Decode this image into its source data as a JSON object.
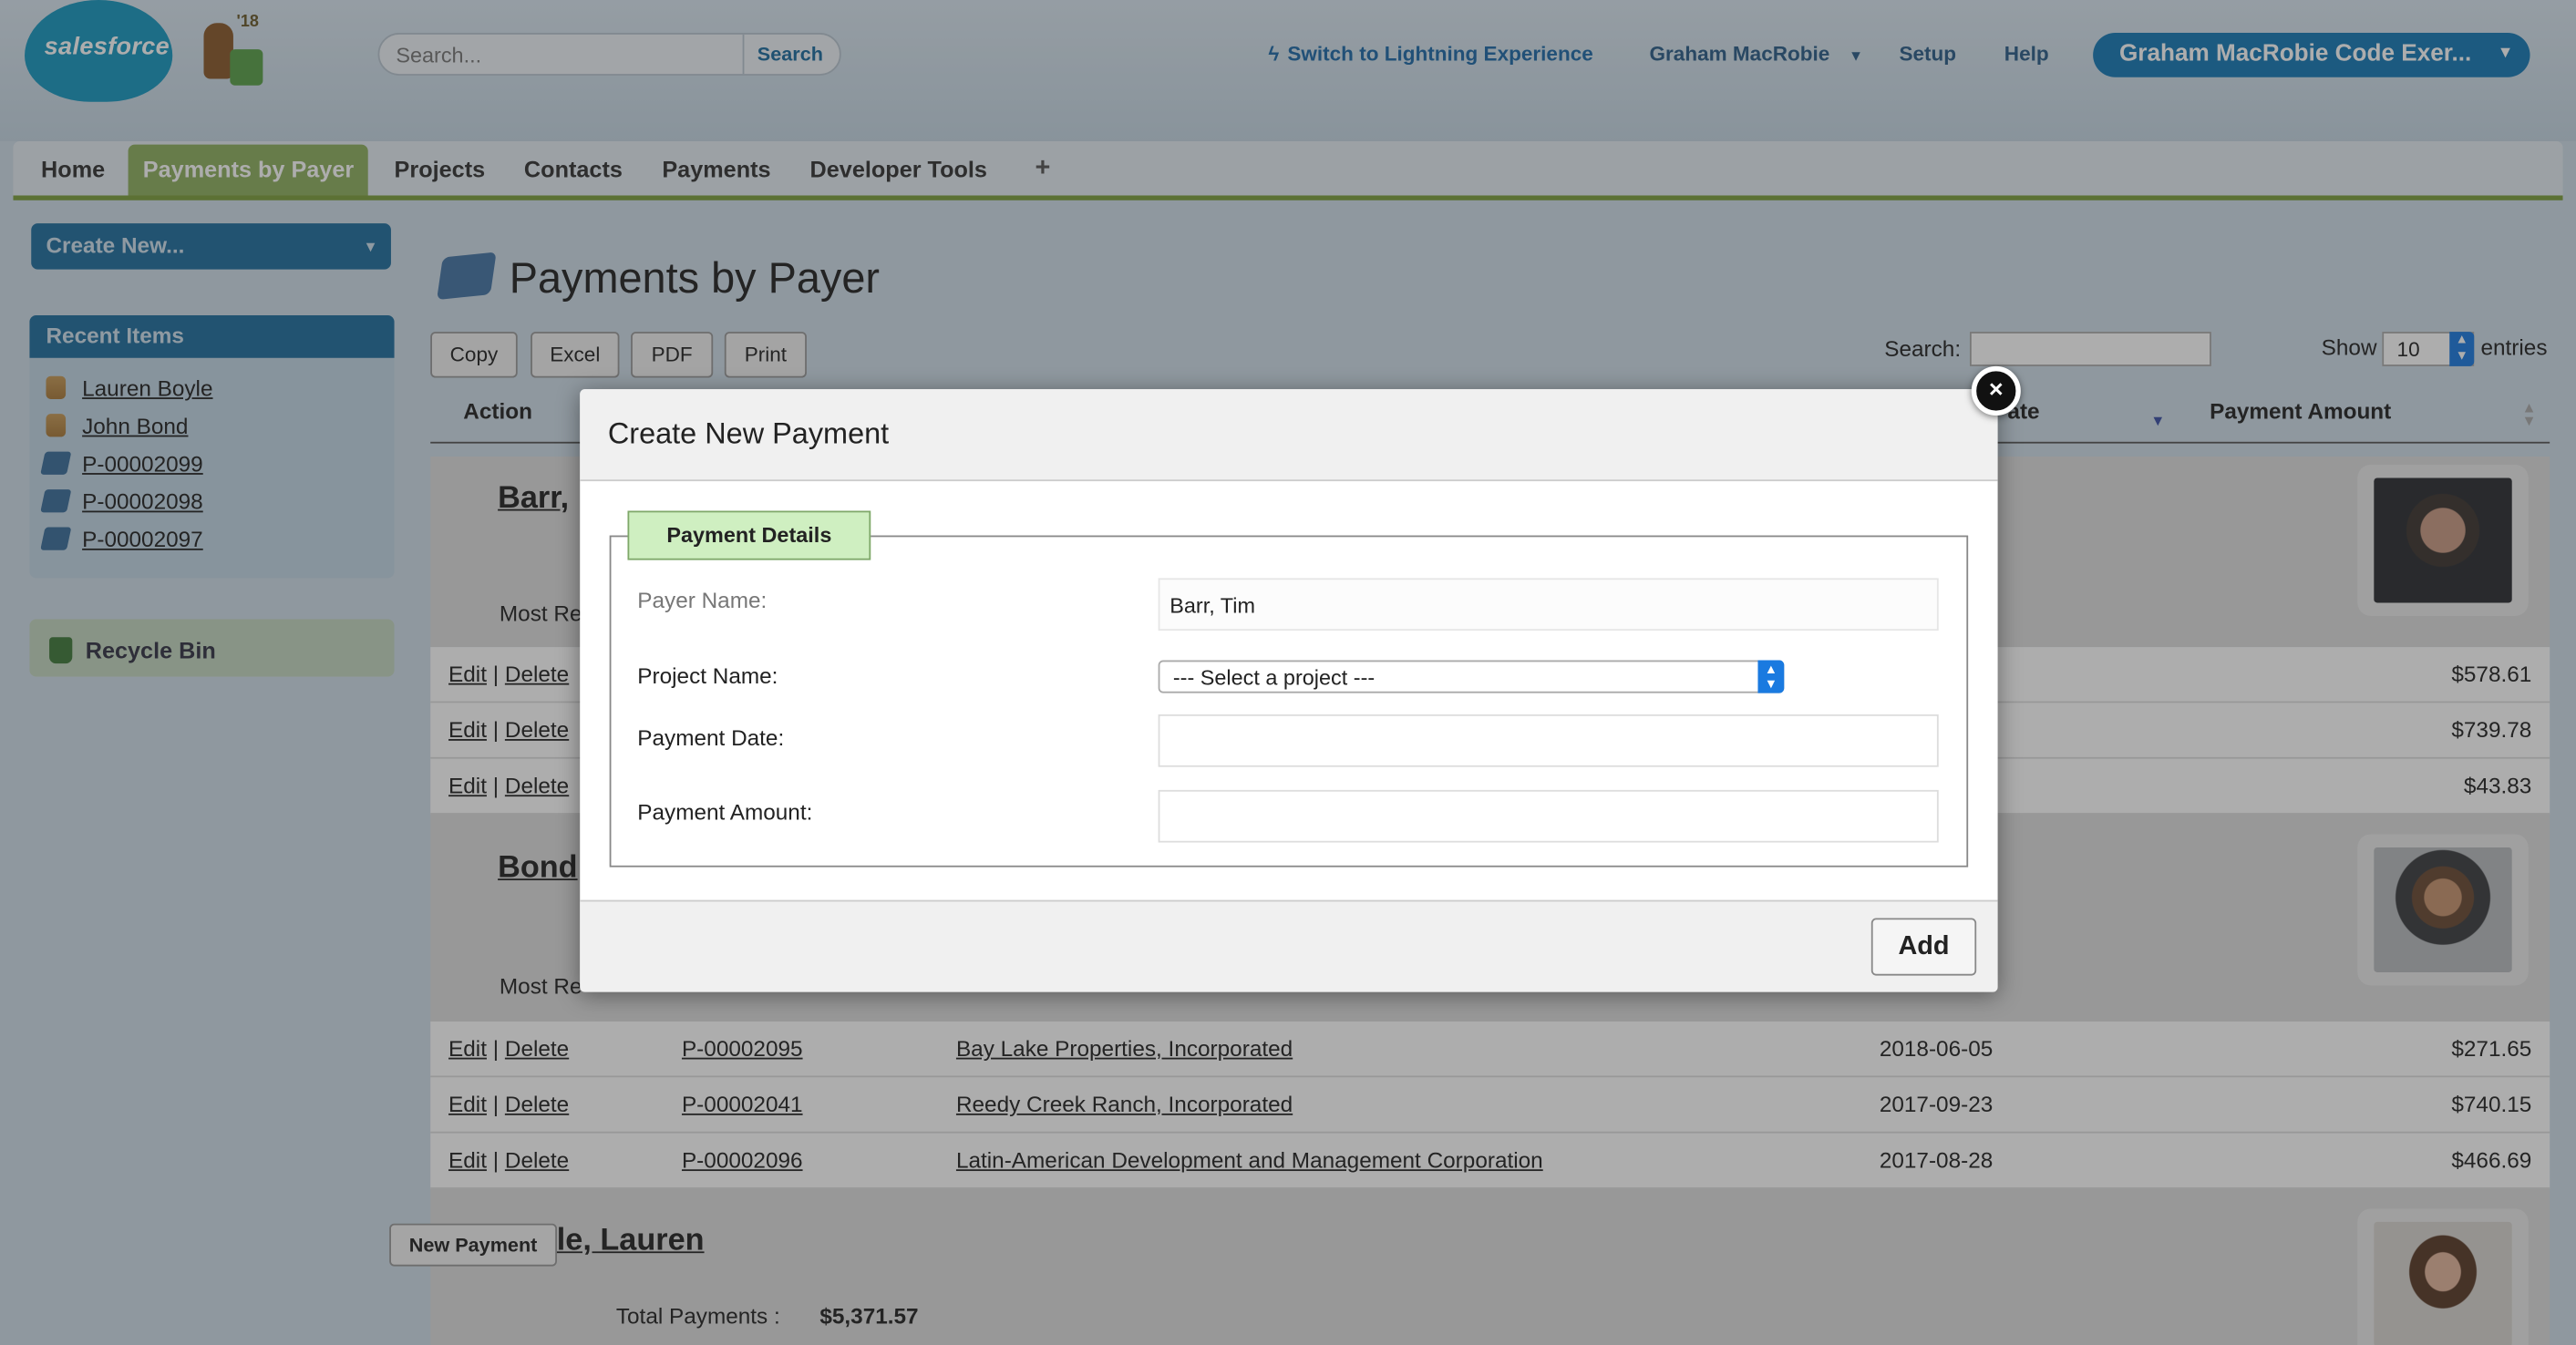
{
  "header": {
    "logo_text": "salesforce",
    "mascot_year": "'18",
    "search_placeholder": "Search...",
    "search_button": "Search",
    "lightning_link": "Switch to Lightning Experience",
    "user_menu": "Graham MacRobie",
    "setup": "Setup",
    "help": "Help",
    "org_menu": "Graham MacRobie Code Exer..."
  },
  "tabs": [
    {
      "label": "Home"
    },
    {
      "label": "Payments by Payer",
      "active": true
    },
    {
      "label": "Projects"
    },
    {
      "label": "Contacts"
    },
    {
      "label": "Payments"
    },
    {
      "label": "Developer Tools"
    },
    {
      "label": "+"
    }
  ],
  "sidebar": {
    "create_new": "Create New...",
    "recent_title": "Recent Items",
    "recent_items": [
      {
        "label": "Lauren Boyle",
        "icon": "contact-icon"
      },
      {
        "label": "John Bond",
        "icon": "contact-icon"
      },
      {
        "label": "P-00002099",
        "icon": "payment-icon"
      },
      {
        "label": "P-00002098",
        "icon": "payment-icon"
      },
      {
        "label": "P-00002097",
        "icon": "payment-icon"
      }
    ],
    "recycle_bin": "Recycle Bin"
  },
  "main": {
    "title": "Payments by Payer",
    "toolbar": [
      "Copy",
      "Excel",
      "PDF",
      "Print"
    ],
    "search_label": "Search:",
    "show_label": "Show",
    "show_value": "10",
    "entries_label": "entries",
    "columns": {
      "action": "Action",
      "date": "ate",
      "amount": "Payment Amount"
    },
    "groups": [
      {
        "name": "Barr,",
        "most_recent": "Most Re"
      },
      {
        "name": "Bond",
        "most_recent": "Most Re"
      },
      {
        "name": "Boyle, Lauren",
        "new_payment": "New Payment",
        "total_label": "Total Payments :",
        "total_value": "$5,371.57"
      }
    ],
    "rows_barr": [
      {
        "edit": "Edit",
        "sep": "|",
        "delete": "Delete",
        "amount": "$578.61"
      },
      {
        "edit": "Edit",
        "sep": "|",
        "delete": "Delete",
        "amount": "$739.78"
      },
      {
        "edit": "Edit",
        "sep": "|",
        "delete": "Delete",
        "amount": "$43.83"
      }
    ],
    "rows_bond": [
      {
        "edit": "Edit",
        "sep": "|",
        "delete": "Delete",
        "id": "P-00002095",
        "project": "Bay Lake Properties, Incorporated",
        "date": "2018-06-05",
        "amount": "$271.65"
      },
      {
        "edit": "Edit",
        "sep": "|",
        "delete": "Delete",
        "id": "P-00002041",
        "project": "Reedy Creek Ranch, Incorporated",
        "date": "2017-09-23",
        "amount": "$740.15"
      },
      {
        "edit": "Edit",
        "sep": "|",
        "delete": "Delete",
        "id": "P-00002096",
        "project": "Latin-American Development and Management Corporation",
        "date": "2017-08-28",
        "amount": "$466.69"
      }
    ]
  },
  "modal": {
    "title": "Create New Payment",
    "legend": "Payment Details",
    "payer_label": "Payer Name:",
    "payer_value": "Barr, Tim",
    "project_label": "Project Name:",
    "project_value": "--- Select a project ---",
    "date_label": "Payment Date:",
    "amount_label": "Payment Amount:",
    "add_button": "Add",
    "close_glyph": "×"
  },
  "colors": {
    "brand": "#1798c1",
    "accent_tab": "#8fb060",
    "sidebar_head": "#1f6f9f",
    "legend_bg": "#cfefc1"
  }
}
